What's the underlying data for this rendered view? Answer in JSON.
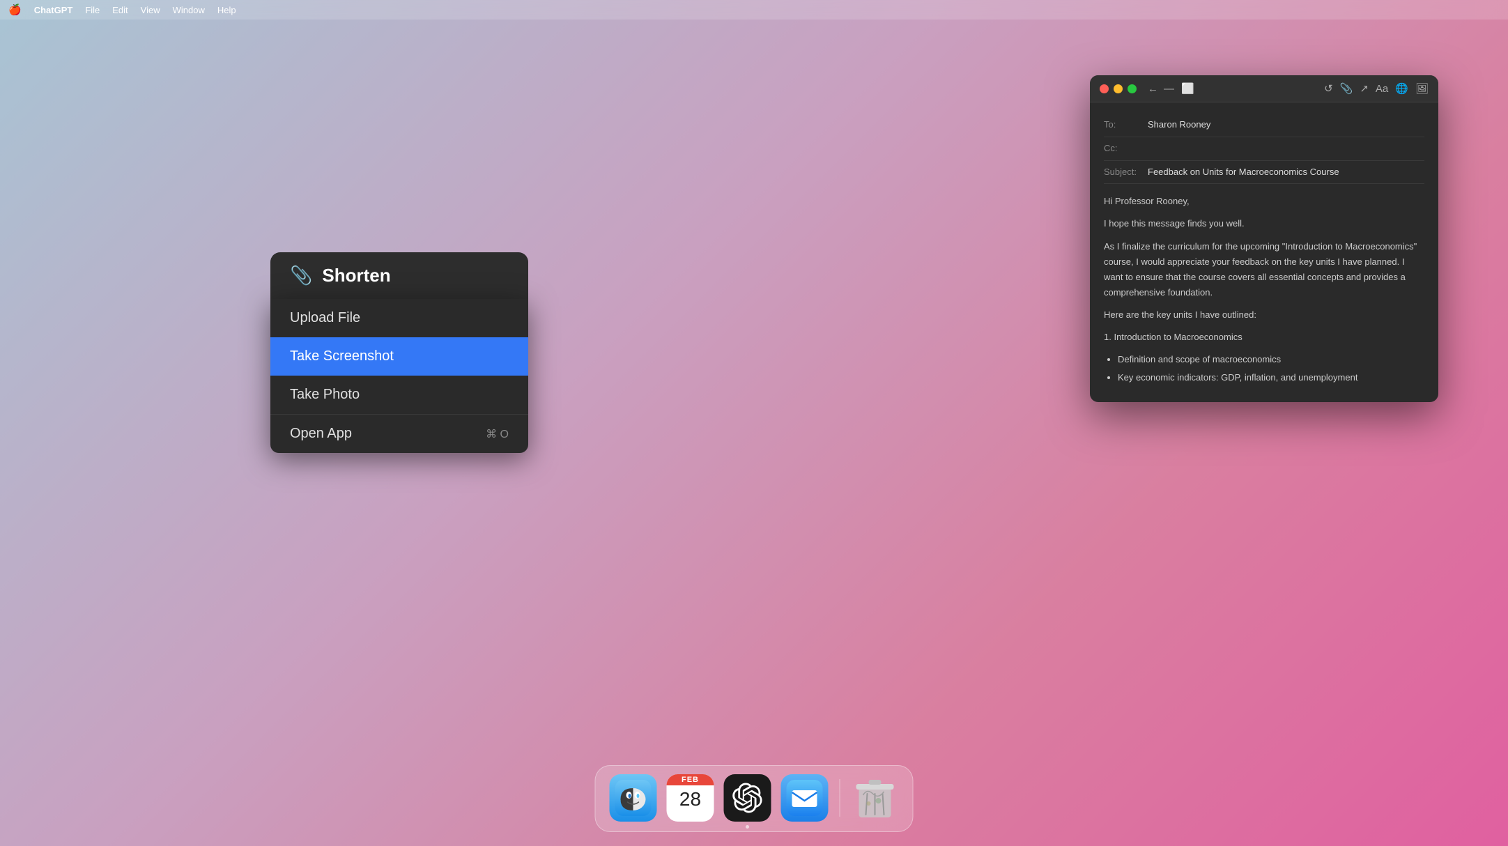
{
  "menubar": {
    "apple": "🍎",
    "app": "ChatGPT",
    "items": [
      "File",
      "Edit",
      "View",
      "Window",
      "Help"
    ]
  },
  "shorten": {
    "title": "Shorten",
    "clip_icon": "📎",
    "menu_items": [
      {
        "label": "Upload File",
        "shortcut": "",
        "active": false
      },
      {
        "label": "Take Screenshot",
        "shortcut": "",
        "active": true
      },
      {
        "label": "Take Photo",
        "shortcut": "",
        "active": false
      },
      {
        "label": "Open App",
        "shortcut": "⌘ O",
        "active": false
      }
    ]
  },
  "mail": {
    "to": "Sharon Rooney",
    "cc": "",
    "subject": "Feedback on Units for Macroeconomics Course",
    "body_greeting": "Hi Professor Rooney,",
    "body_line1": "I hope this message finds you well.",
    "body_line2": "As I finalize the curriculum for the upcoming \"Introduction to Macroeconomics\" course, I would appreciate your feedback on the key units I have planned. I want to ensure that the course covers all essential concepts and provides a comprehensive foundation.",
    "body_line3": "Here are the key units I have outlined:",
    "unit1_title": "1. Introduction to Macroeconomics",
    "unit1_bullets": [
      "Definition and scope of macroeconomics",
      "Key economic indicators: GDP, inflation, and unemployment"
    ]
  },
  "dock": {
    "items": [
      {
        "name": "Finder",
        "label": "Finder"
      },
      {
        "name": "Calendar",
        "month": "FEB",
        "date": "28"
      },
      {
        "name": "ChatGPT",
        "label": "ChatGPT"
      },
      {
        "name": "Mail",
        "label": "Mail"
      },
      {
        "name": "Trash",
        "label": "Trash"
      }
    ]
  }
}
